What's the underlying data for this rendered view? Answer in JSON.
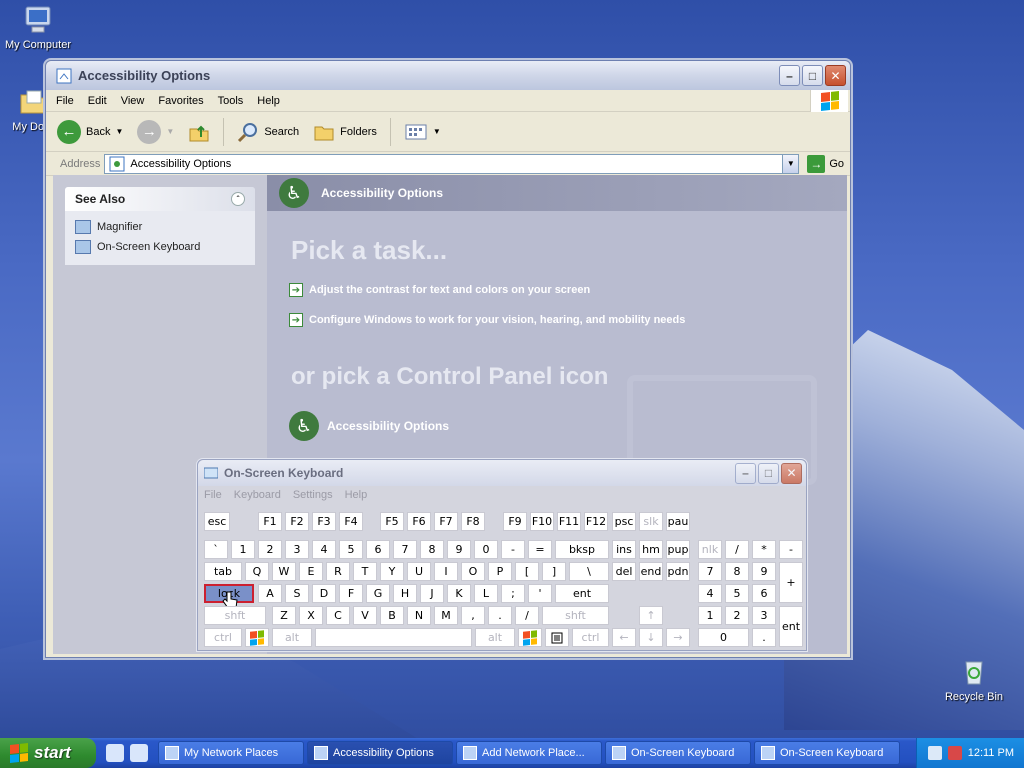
{
  "desktop": {
    "icons": [
      {
        "label": "My Computer"
      },
      {
        "label": "My Docu"
      },
      {
        "label": "Recycle Bin"
      }
    ]
  },
  "explorer": {
    "title": "Accessibility Options",
    "menu": [
      "File",
      "Edit",
      "View",
      "Favorites",
      "Tools",
      "Help"
    ],
    "toolbar": {
      "back": "Back",
      "search": "Search",
      "folders": "Folders"
    },
    "address": {
      "label": "Address",
      "value": "Accessibility Options",
      "go": "Go"
    },
    "see_also": {
      "header": "See Also",
      "items": [
        "Magnifier",
        "On-Screen Keyboard"
      ]
    },
    "banner": "Accessibility Options",
    "pick_task": "Pick a task...",
    "tasks": [
      "Adjust the contrast for text and colors on your screen",
      "Configure Windows to work for your vision, hearing, and mobility needs"
    ],
    "pick_icon": "or pick a Control Panel icon",
    "cp_icon": "Accessibility Options"
  },
  "osk": {
    "title": "On-Screen Keyboard",
    "menu": [
      "File",
      "Keyboard",
      "Settings",
      "Help"
    ]
  },
  "taskbar": {
    "start": "start",
    "buttons": [
      "My Network Places",
      "Accessibility Options",
      "Add Network Place...",
      "On-Screen Keyboard",
      "On-Screen Keyboard"
    ],
    "clock": "12:11 PM"
  }
}
